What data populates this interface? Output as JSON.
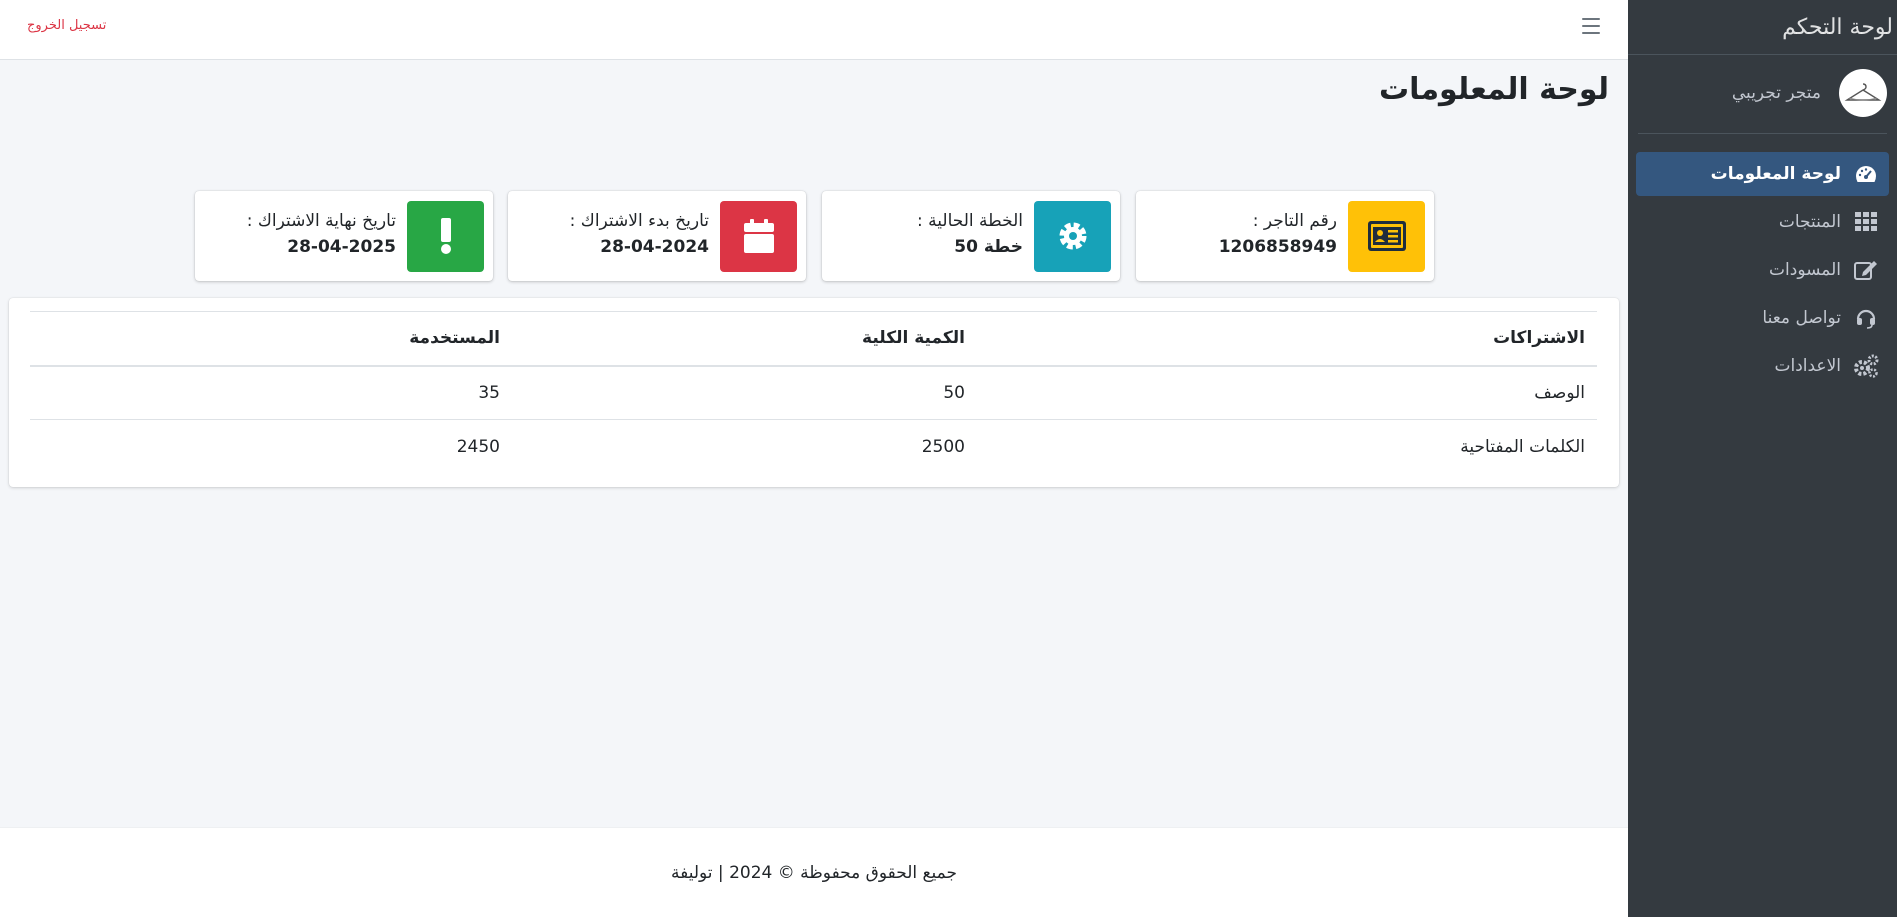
{
  "topbar": {
    "logout_label": "تسجيل الخروج"
  },
  "sidebar": {
    "brand": "لوحة التحكم",
    "user_name": "متجر تجريبي",
    "items": [
      {
        "label": "لوحة المعلومات",
        "icon": "tachometer-icon",
        "active": true
      },
      {
        "label": "المنتجات",
        "icon": "grid-icon",
        "active": false
      },
      {
        "label": "المسودات",
        "icon": "edit-icon",
        "active": false
      },
      {
        "label": "تواصل معنا",
        "icon": "headset-icon",
        "active": false
      },
      {
        "label": "الاعدادات",
        "icon": "gears-icon",
        "active": false
      }
    ]
  },
  "page": {
    "title": "لوحة المعلومات"
  },
  "info_boxes": [
    {
      "label": "رقم التاجر :",
      "value": "1206858949",
      "icon": "id-card-icon",
      "color": "#ffc107"
    },
    {
      "label": "الخطة الحالية :",
      "value": "خطة 50",
      "icon": "cog-icon",
      "color": "#17a2b8"
    },
    {
      "label": "تاريخ بدء الاشتراك :",
      "value": "28-04-2024",
      "icon": "calendar-icon",
      "color": "#dc3545"
    },
    {
      "label": "تاريخ نهاية الاشتراك :",
      "value": "28-04-2025",
      "icon": "exclamation-icon",
      "color": "#28a745"
    }
  ],
  "subscriptions_table": {
    "headers": [
      "الاشتراكات",
      "الكمية الكلية",
      "المستخدمة"
    ],
    "rows": [
      [
        "الوصف",
        "50",
        "35"
      ],
      [
        "الكلمات المفتاحية",
        "2500",
        "2450"
      ]
    ]
  },
  "footer": {
    "text": "جميع الحقوق محفوظة © 2024 | توليفة"
  }
}
